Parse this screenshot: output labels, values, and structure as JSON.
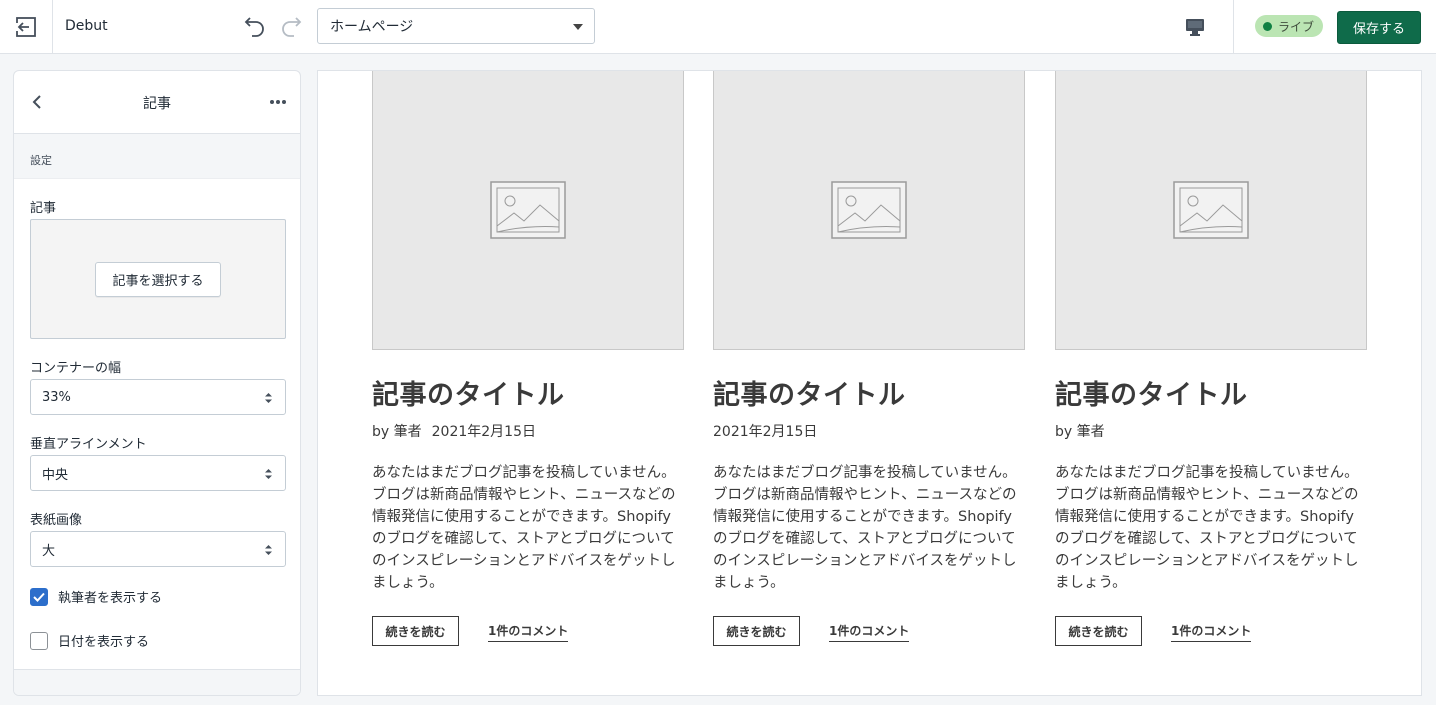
{
  "topbar": {
    "theme_name": "Debut",
    "page_select": "ホームページ",
    "live_label": "ライブ",
    "save_label": "保存する",
    "exit_icon": "exit-icon",
    "undo_icon": "undo-icon",
    "redo_icon": "redo-icon",
    "device_icon": "desktop-icon",
    "accent_color": "#0f6b4a",
    "live_color": "#108043"
  },
  "sidebar": {
    "title": "記事",
    "section": "設定",
    "article_label": "記事",
    "select_article_button": "記事を選択する",
    "container_width_label": "コンテナーの幅",
    "container_width_value": "33%",
    "vertical_align_label": "垂直アラインメント",
    "vertical_align_value": "中央",
    "cover_image_label": "表紙画像",
    "cover_image_value": "大",
    "show_author": {
      "label": "執筆者を表示する",
      "checked": true
    },
    "show_date": {
      "label": "日付を表示する",
      "checked": false
    },
    "checkbox_color": "#2c6ecb"
  },
  "preview": {
    "cards": [
      {
        "title": "記事のタイトル",
        "author": "by 筆者",
        "date": "2021年2月15日",
        "excerpt": "あなたはまだブログ記事を投稿していません。ブログは新商品情報やヒント、ニュースなどの情報発信に使用することができます。Shopifyのブログを確認して、ストアとブログについてのインスピレーションとアドバイスをゲットしましょう。",
        "read_more": "続きを読む",
        "comments": "1件のコメント"
      },
      {
        "title": "記事のタイトル",
        "author": "",
        "date": "2021年2月15日",
        "excerpt": "あなたはまだブログ記事を投稿していません。ブログは新商品情報やヒント、ニュースなどの情報発信に使用することができます。Shopifyのブログを確認して、ストアとブログについてのインスピレーションとアドバイスをゲットしましょう。",
        "read_more": "続きを読む",
        "comments": "1件のコメント"
      },
      {
        "title": "記事のタイトル",
        "author": "by 筆者",
        "date": "",
        "excerpt": "あなたはまだブログ記事を投稿していません。ブログは新商品情報やヒント、ニュースなどの情報発信に使用することができます。Shopifyのブログを確認して、ストアとブログについてのインスピレーションとアドバイスをゲットしましょう。",
        "read_more": "続きを読む",
        "comments": "1件のコメント"
      }
    ]
  }
}
